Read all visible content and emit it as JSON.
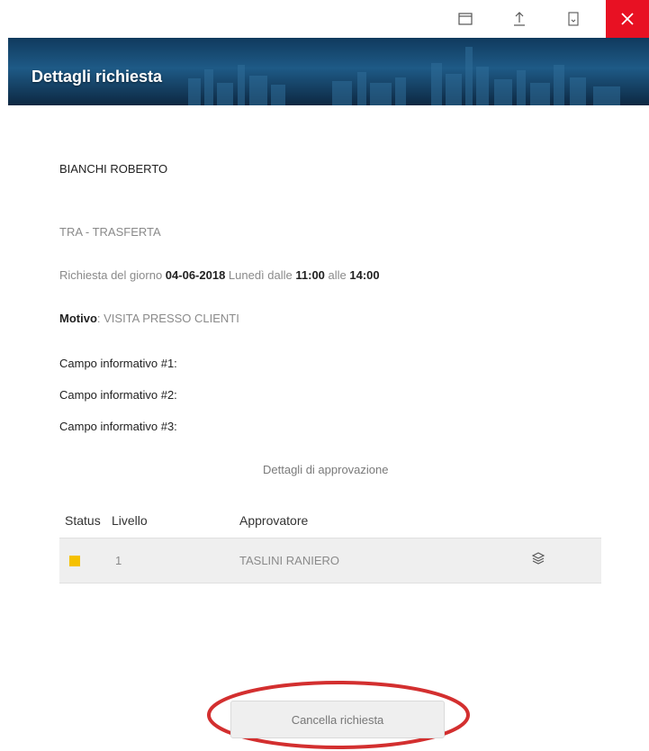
{
  "window": {
    "icons": [
      "window-icon",
      "share-icon",
      "bookmark-icon",
      "close-icon"
    ]
  },
  "header": {
    "title": "Dettagli richiesta"
  },
  "request": {
    "employee": "BIANCHI ROBERTO",
    "type": "TRA - TRASFERTA",
    "date_prefix": "Richiesta del giorno ",
    "date": "04-06-2018",
    "weekday_text": " Lunedì dalle ",
    "time_from": "11:00",
    "time_mid": " alle ",
    "time_to": "14:00",
    "motivo_label": "Motivo",
    "motivo_value": ": VISITA PRESSO CLIENTI",
    "fields": [
      "Campo informativo #1:",
      "Campo informativo #2:",
      "Campo informativo #3:"
    ]
  },
  "approval": {
    "title": "Dettagli di approvazione",
    "headers": {
      "status": "Status",
      "level": "Livello",
      "approver": "Approvatore"
    },
    "rows": [
      {
        "status_color": "#f5c100",
        "level": "1",
        "approver": "TASLINI RANIERO",
        "icon": "stack-icon"
      }
    ]
  },
  "actions": {
    "cancel_label": "Cancella richiesta",
    "highlight_color": "#d32f2f"
  }
}
